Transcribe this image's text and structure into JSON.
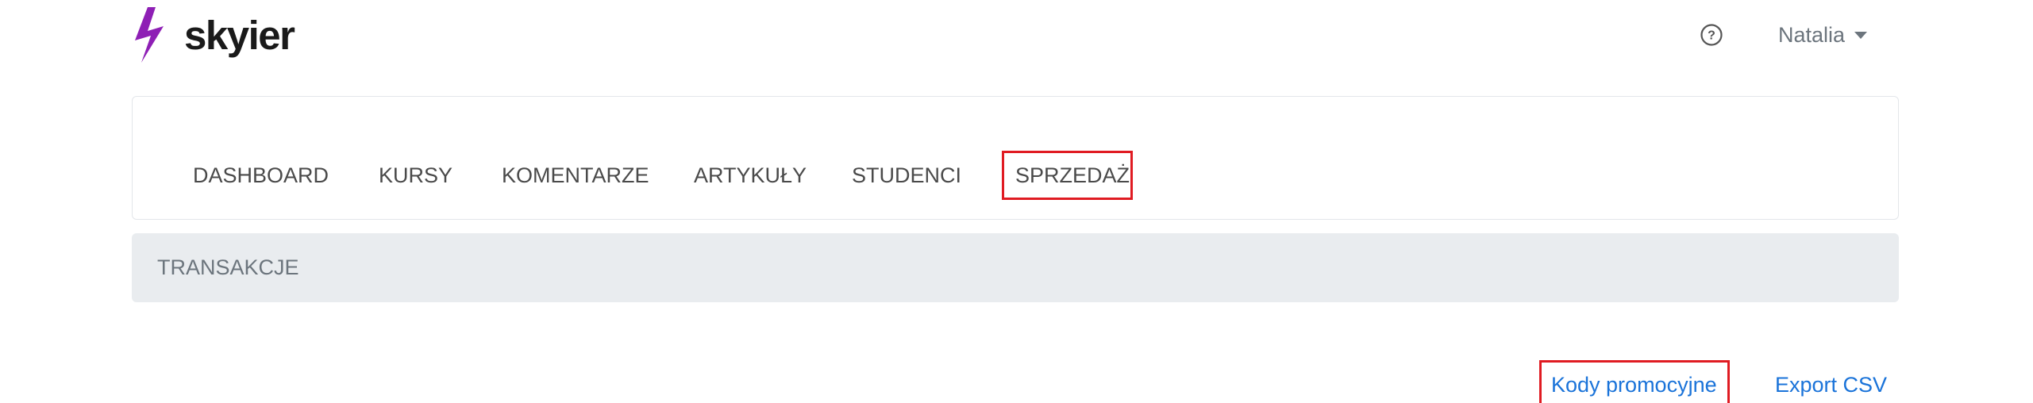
{
  "header": {
    "brand": "skyier",
    "help_icon": "question-circle-icon",
    "user_name": "Natalia"
  },
  "nav": {
    "items": [
      {
        "label": "DASHBOARD"
      },
      {
        "label": "KURSY"
      },
      {
        "label": "KOMENTARZE"
      },
      {
        "label": "ARTYKUŁY"
      },
      {
        "label": "STUDENCI"
      },
      {
        "label": "SPRZEDAŻ",
        "active": true
      }
    ]
  },
  "section": {
    "title": "TRANSAKCJE"
  },
  "actions": {
    "promo_codes": "Kody promocyjne",
    "export_csv": "Export CSV"
  },
  "colors": {
    "brand_bolt": "#8e1fb5",
    "link": "#1a73d9",
    "highlight": "#e01b22",
    "section_bg": "#e9ecef"
  }
}
